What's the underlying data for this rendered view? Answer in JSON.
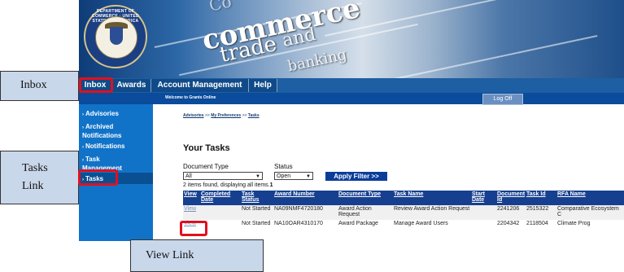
{
  "banner": {
    "seal_text": "DEPARTMENT OF COMMERCE · UNITED STATES OF AMERICA",
    "words": [
      "commerce",
      "trade",
      "and",
      "banking",
      "Co"
    ]
  },
  "nav": {
    "tabs": [
      "Inbox",
      "Awards",
      "Account Management",
      "Help"
    ],
    "welcome": "Welcome to Grants Online",
    "logoff": "Log Off"
  },
  "sidebar": {
    "items": [
      "Advisories",
      "Archived Notifications",
      "Notifications",
      "Task Management",
      "Tasks"
    ]
  },
  "breadcrumb": {
    "items": [
      "Advisories",
      "My Preferences",
      "Tasks"
    ],
    "separator": ">>"
  },
  "main": {
    "title": "Your Tasks",
    "document_type_label": "Document Type",
    "document_type_value": "All",
    "status_label": "Status",
    "status_value": "Open",
    "apply_label": "Apply Filter >>",
    "found_text": "2 items found, displaying all items.",
    "found_count": "1"
  },
  "table": {
    "headers": [
      "View",
      "Completed Date",
      "Task Status",
      "Award Number",
      "Document Type",
      "Task Name",
      "Start Date",
      "Document Id",
      "Task Id",
      "RFA Name"
    ],
    "rows": [
      [
        "View",
        "",
        "Not Started",
        "NA09NMF4720180",
        "Award Action Request",
        "Review Award Action Request",
        "",
        "2241206",
        "2515322",
        "Comparative Ecosystem C"
      ],
      [
        "View",
        "",
        "Not Started",
        "NA10OAR4310170",
        "Award Package",
        "Manage Award Users",
        "",
        "2204342",
        "2118504",
        "Climate Prog"
      ]
    ]
  },
  "callouts": {
    "inbox": "Inbox",
    "tasks_line1": "Tasks",
    "tasks_line2": "Link",
    "view": "View Link"
  },
  "colors": {
    "highlight": "#e0101f",
    "callout_bg": "#c9d7ea",
    "nav_blue": "#1e5ea3",
    "sidebar_blue": "#1173c8"
  }
}
